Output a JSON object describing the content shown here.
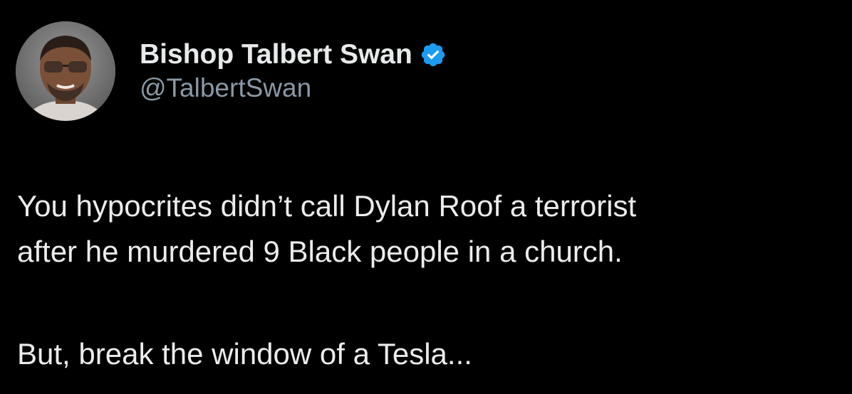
{
  "tweet": {
    "author": {
      "display_name": "Bishop Talbert Swan",
      "handle": "@TalbertSwan",
      "verified": true,
      "verified_icon": "verified-badge-icon",
      "avatar": "profile-photo"
    },
    "text_lines": [
      "You hypocrites didn’t call Dylan Roof a terrorist",
      "after he murdered 9 Black people in a church.",
      "But, break the window of a Tesla..."
    ]
  },
  "colors": {
    "background": "#000000",
    "text": "#e7e9ea",
    "handle": "#8b98a5",
    "verified": "#1d9bf0"
  }
}
